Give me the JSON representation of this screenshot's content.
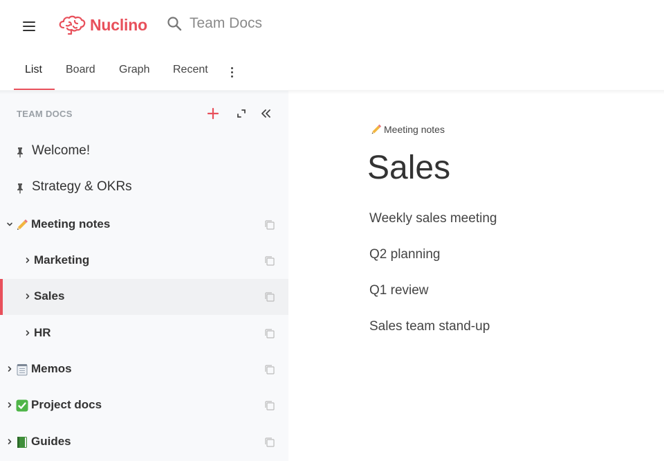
{
  "header": {
    "logo_text": "Nuclino",
    "search_text": "Team Docs",
    "brand_color": "#e8505b"
  },
  "tabs": [
    {
      "label": "List",
      "active": true
    },
    {
      "label": "Board"
    },
    {
      "label": "Graph"
    },
    {
      "label": "Recent"
    }
  ],
  "sidebar": {
    "title": "TEAM DOCS",
    "items": [
      {
        "label": "Welcome!",
        "pinned": true
      },
      {
        "label": "Strategy & OKRs",
        "pinned": true
      },
      {
        "label": "Meeting notes",
        "expanded": true,
        "icon": "pencil-icon"
      },
      {
        "label": "Marketing"
      },
      {
        "label": "Sales",
        "selected": true
      },
      {
        "label": "HR"
      },
      {
        "label": "Memos",
        "icon": "notepad-icon"
      },
      {
        "label": "Project docs",
        "icon": "check-mark-icon"
      },
      {
        "label": "Guides",
        "icon": "green-book-icon"
      }
    ]
  },
  "content": {
    "breadcrumb": "Meeting notes",
    "title": "Sales",
    "links": [
      "Weekly sales meeting",
      "Q2 planning",
      "Q1 review",
      "Sales team stand-up"
    ]
  }
}
